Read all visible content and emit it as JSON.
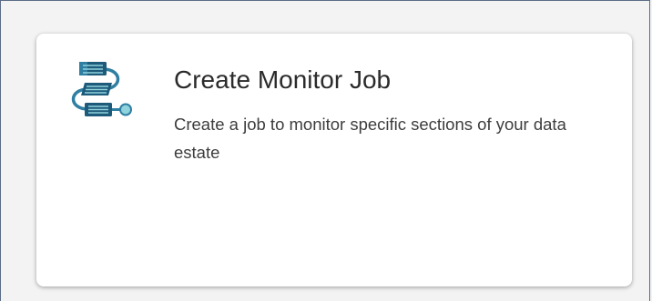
{
  "card": {
    "title": "Create Monitor Job",
    "description": "Create a job to monitor specific sections of your data estate",
    "icon": "monitor-job-workflow-icon"
  },
  "colors": {
    "icon_dark": "#1e5a7a",
    "icon_mid": "#2f7fa3",
    "icon_light": "#8fd3dc",
    "title_text": "#2b2b2b",
    "desc_text": "#3d3d3d"
  }
}
